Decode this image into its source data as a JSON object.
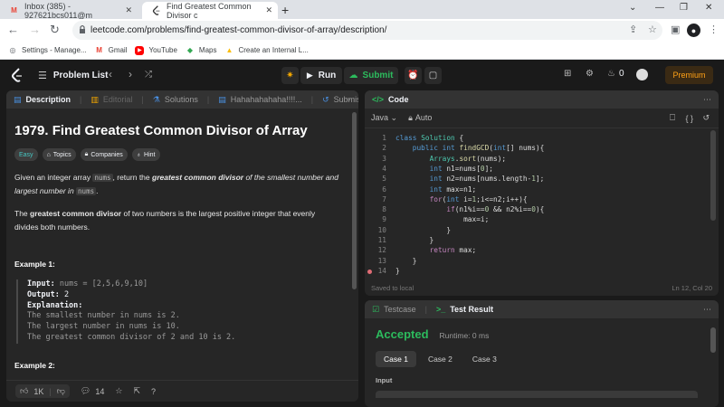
{
  "browser": {
    "tabs": [
      {
        "title": "Inbox (385) - 927621bcs011@m",
        "favicon": "gmail-icon"
      },
      {
        "title": "Find Greatest Common Divisor c",
        "favicon": "leetcode-icon"
      }
    ],
    "new_tab": "+",
    "window_controls": [
      "⌄",
      "—",
      "❐",
      "✕"
    ],
    "url": "leetcode.com/problems/find-greatest-common-divisor-of-array/description/",
    "profile_initial": "●",
    "bookmarks": [
      {
        "label": "Settings - Manage...",
        "icon": "globe-icon"
      },
      {
        "label": "Gmail",
        "icon": "gmail-icon"
      },
      {
        "label": "YouTube",
        "icon": "youtube-icon"
      },
      {
        "label": "Maps",
        "icon": "maps-icon"
      },
      {
        "label": "Create an Internal L...",
        "icon": "drive-icon"
      }
    ]
  },
  "lcnav": {
    "problem_list": "Problem List",
    "run": "Run",
    "submit": "Submit",
    "fire_count": "0",
    "premium": "Premium"
  },
  "desc_panel": {
    "tabs": [
      "Description",
      "Editorial",
      "Solutions",
      "Hahahahahaha!!!!...",
      "Submiss"
    ],
    "title": "1979. Find Greatest Common Divisor of Array",
    "badges": [
      "Easy",
      "Topics",
      "Companies",
      "Hint"
    ],
    "para1_a": "Given an integer array ",
    "para1_code1": "nums",
    "para1_b": ", return the ",
    "para1_bold": "greatest common divisor",
    "para1_c": " of the smallest number and",
    "para1_d": "largest number in ",
    "para1_code2": "nums",
    "para1_e": ".",
    "para2_a": "The ",
    "para2_bold": "greatest common divisor",
    "para2_b": " of two numbers is the largest positive integer that evenly",
    "para2_c": "divides both numbers.",
    "example1_heading": "Example 1:",
    "example1": {
      "input_label": "Input:",
      "input_value": " nums = [2,5,6,9,10]",
      "output_label": "Output:",
      "output_value": " 2",
      "explanation_label": "Explanation:",
      "lines": [
        "The smallest number in nums is 2.",
        "The largest number in nums is 10.",
        "The greatest common divisor of 2 and 10 is 2."
      ]
    },
    "example2_heading": "Example 2:",
    "likes": "1K",
    "comments": "14"
  },
  "code_panel": {
    "title": "Code",
    "language": "Java",
    "mode": "Auto",
    "saved": "Saved to local",
    "cursor": "Ln 12, Col 20",
    "lines": [
      "class Solution {",
      "    public int findGCD(int[] nums){",
      "        Arrays.sort(nums);",
      "        int n1=nums[0];",
      "        int n2=nums[nums.length-1];",
      "        int max=n1;",
      "        for(int i=1;i<=n2;i++){",
      "            if(n1%i==0 && n2%i==0){",
      "                max=i;",
      "            }",
      "        }",
      "        return max;",
      "    }",
      "}"
    ]
  },
  "test_panel": {
    "tabs": [
      "Testcase",
      "Test Result"
    ],
    "status": "Accepted",
    "runtime": "Runtime: 0 ms",
    "cases": [
      "Case 1",
      "Case 2",
      "Case 3"
    ],
    "input_label": "Input"
  },
  "colors": {
    "accent_green": "#2cbb5d",
    "easy": "#46c6c2",
    "premium": "#ffa116"
  }
}
